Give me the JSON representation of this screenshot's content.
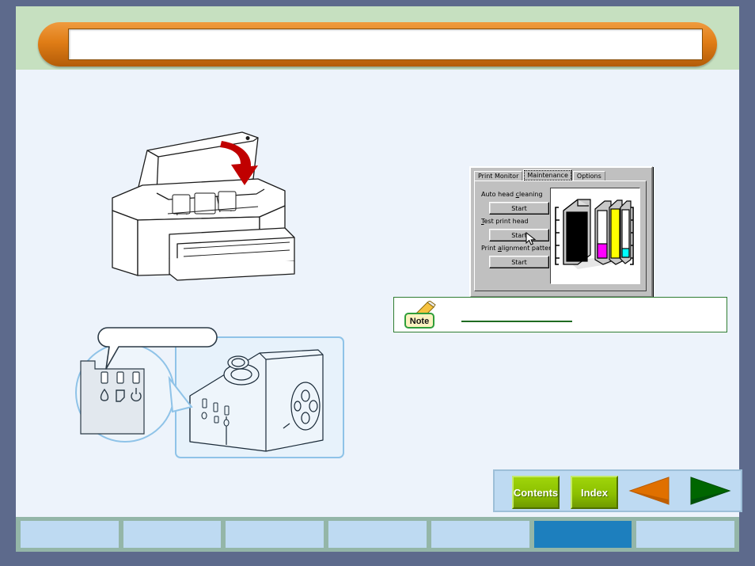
{
  "header": {
    "title": ""
  },
  "illustrations": {
    "printer": {
      "name": "printer-with-open-lid",
      "arrow": "close-lid-arrow",
      "arrow_color": "#c00000"
    },
    "control_panel": {
      "name": "printer-control-panel-callout",
      "callout_bubble_text": "",
      "indicator_icons": [
        "ink-drop-icon",
        "paper-sheet-icon",
        "power-icon"
      ],
      "indicator_count": 3
    }
  },
  "dialog": {
    "title": "",
    "tabs": [
      {
        "label": "Print Monitor",
        "active": false
      },
      {
        "label": "Maintenance",
        "active": true
      },
      {
        "label": "Options",
        "active": false
      }
    ],
    "operations": [
      {
        "label": "Auto head cleaning",
        "accel": "c",
        "button": "Start"
      },
      {
        "label": "Test print head",
        "accel": "T",
        "button": "Start"
      },
      {
        "label": "Print alignment patterns",
        "accel": "a",
        "button": "Start"
      }
    ],
    "ink_preview": {
      "name": "ink-cartridge-illustration",
      "cartridges": [
        {
          "name": "black",
          "color": "#000000"
        },
        {
          "name": "magenta",
          "color": "#ff00ff"
        },
        {
          "name": "yellow",
          "color": "#ffff00"
        },
        {
          "name": "cyan",
          "color": "#00ffff"
        }
      ]
    },
    "cursor_on_button_index": 1
  },
  "note": {
    "badge_label": "Note",
    "text": "",
    "border_color": "#2f7d32",
    "badge_bg": "#fbf2c0"
  },
  "nav": {
    "contents_label": "Contents",
    "index_label": "Index",
    "back_label": "",
    "next_label": "",
    "button_color": "#8cc000",
    "back_arrow_color": "#e07000",
    "next_arrow_color": "#006600"
  },
  "footer": {
    "tabs": [
      {
        "label": "",
        "selected": false
      },
      {
        "label": "",
        "selected": false
      },
      {
        "label": "",
        "selected": false
      },
      {
        "label": "",
        "selected": false
      },
      {
        "label": "",
        "selected": false
      },
      {
        "label": "",
        "selected": true
      },
      {
        "label": "",
        "selected": false
      }
    ],
    "selected_color": "#1d7fbe",
    "tab_color": "#bedaf2",
    "strip_color": "#94b6a8"
  },
  "theme": {
    "frame_color": "#5d6a8c",
    "page_bg": "#edf3fb",
    "header_band": "#c6e0c0",
    "banner_orange": "#e07d16"
  }
}
